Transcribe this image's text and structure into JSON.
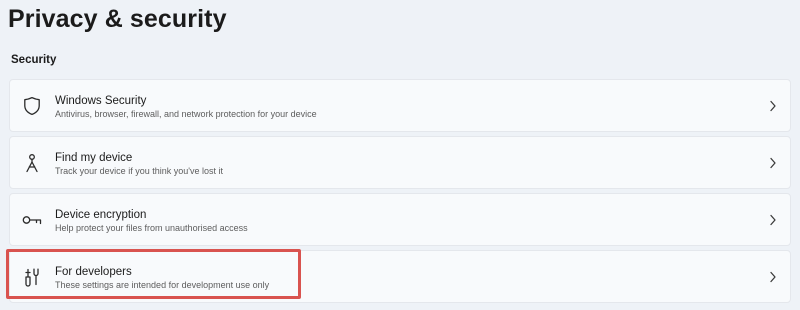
{
  "page": {
    "title": "Privacy & security"
  },
  "section": {
    "label": "Security"
  },
  "items": [
    {
      "icon": "shield-icon",
      "title": "Windows Security",
      "subtitle": "Antivirus, browser, firewall, and network protection for your device"
    },
    {
      "icon": "find-device-icon",
      "title": "Find my device",
      "subtitle": "Track your device if you think you've lost it"
    },
    {
      "icon": "encryption-key-icon",
      "title": "Device encryption",
      "subtitle": "Help protect your files from unauthorised access"
    },
    {
      "icon": "developer-tools-icon",
      "title": "For developers",
      "subtitle": "These settings are intended for development use only"
    }
  ],
  "annotation": {
    "highlight_color": "#d9534f",
    "highlighted_item": "For developers"
  }
}
